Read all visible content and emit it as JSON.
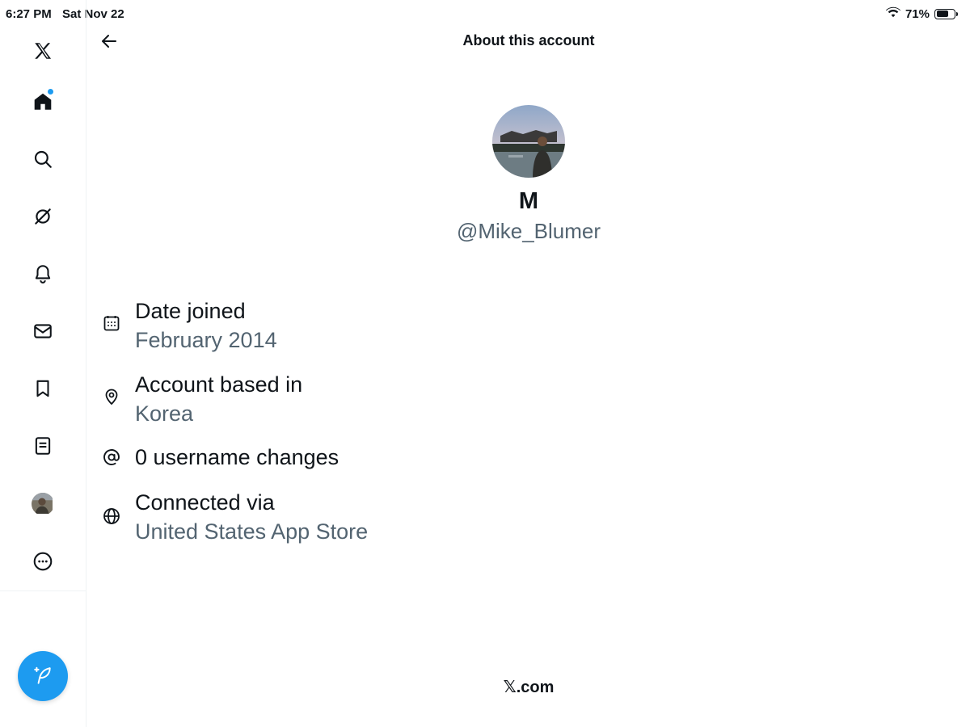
{
  "status_bar": {
    "time": "6:27 PM",
    "date": "Sat Nov 22",
    "battery_percent": "71%",
    "battery_level": 0.71,
    "wifi_icon": "wifi-icon"
  },
  "sidebar": {
    "items": [
      {
        "name": "x-logo",
        "icon": "x-logo-icon"
      },
      {
        "name": "home",
        "icon": "home-icon",
        "has_notification_dot": true
      },
      {
        "name": "search",
        "icon": "search-icon"
      },
      {
        "name": "grok",
        "icon": "grok-icon"
      },
      {
        "name": "notifications",
        "icon": "bell-icon"
      },
      {
        "name": "messages",
        "icon": "mail-icon"
      },
      {
        "name": "bookmarks",
        "icon": "bookmark-icon"
      },
      {
        "name": "lists",
        "icon": "list-icon"
      },
      {
        "name": "profile",
        "icon": "avatar"
      },
      {
        "name": "more",
        "icon": "more-icon"
      }
    ],
    "compose_icon": "compose-icon"
  },
  "header": {
    "title": "About this account",
    "back_icon": "arrow-left-icon"
  },
  "profile": {
    "display_name": "M",
    "handle": "@Mike_Blumer"
  },
  "details": [
    {
      "icon": "calendar-icon",
      "label": "Date joined",
      "value": "February 2014"
    },
    {
      "icon": "location-icon",
      "label": "Account based in",
      "value": "Korea"
    },
    {
      "icon": "at-icon",
      "label": "0 username changes",
      "value": ""
    },
    {
      "icon": "globe-icon",
      "label": "Connected via",
      "value": "United States App Store"
    }
  ],
  "footer": {
    "brand": "𝕏.com"
  },
  "colors": {
    "accent": "#1d9bf0",
    "text_primary": "#0f1419",
    "text_secondary": "#536471",
    "divider": "#eff3f4"
  }
}
